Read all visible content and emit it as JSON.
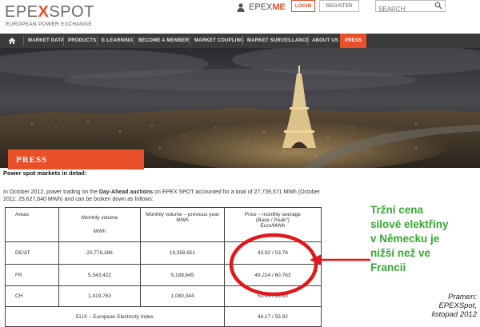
{
  "header": {
    "logo_text_a": "EPE",
    "logo_text_x": "X",
    "logo_text_b": "SPOT",
    "logo_subtitle": "EUROPEAN POWER EXCHANGE",
    "epexme_a": "EPEX",
    "epexme_b": "ME",
    "login_label": "LOGIN",
    "register_label": "REGISTER",
    "search_placeholder": "SEARCH"
  },
  "nav": {
    "items": [
      {
        "label": "MARKET DATA"
      },
      {
        "label": "PRODUCTS"
      },
      {
        "label": "E-LEARNING"
      },
      {
        "label": "BECOME A MEMBER"
      },
      {
        "label": "MARKET COUPLING"
      },
      {
        "label": "MARKET SURVEILLANCE"
      },
      {
        "label": "ABOUT US"
      },
      {
        "label": "PRESS"
      }
    ]
  },
  "hero": {
    "press_label": "PRESS"
  },
  "content": {
    "section_title": "Power spot markets in detail:",
    "intro_a": "In October 2012, power trading on the ",
    "intro_bold": "Day-Ahead auctions",
    "intro_b": " on EPEX SPOT accounted for a total of 27,739,571 MWh (October 2011: 25,627,640 MWh) and can be broken down as follows:"
  },
  "table": {
    "headers": {
      "areas": "Areas",
      "monthly_volume": "Monthly volume",
      "monthly_volume_unit": "MWh",
      "prev_volume": "Monthly volume – previous year",
      "prev_volume_unit": "MWh",
      "price": "Price – monthly average",
      "price_sub": "(Base / Peak*)",
      "price_unit": "Euro/MWh"
    },
    "rows": [
      {
        "area": "DE/AT",
        "volume": "20,776,386",
        "prev": "19,358,651",
        "price": "43.92 / 53.76"
      },
      {
        "area": "FR",
        "volume": "5,543,422",
        "prev": "5,188,645",
        "price": "49.224 / 60.763"
      },
      {
        "area": "CH",
        "volume": "1,419,763",
        "prev": "1,080,344",
        "price": "53.43 / 63.60"
      }
    ],
    "elix_label": "ELIX – European Electricity Index",
    "elix_price": "44.17 / 55.92"
  },
  "annotation": {
    "line1": "Tržní cena",
    "line2": "silové elektřiny",
    "line3": "v Německu je",
    "line4": "nižší než ve",
    "line5": "Francii",
    "color": "#36a832"
  },
  "source": {
    "line1": "Pramen:",
    "line2": "EPEXSpot,",
    "line3": "listopad 2012"
  },
  "colors": {
    "accent": "#e8502a",
    "nav_bg": "#3b3b3b",
    "highlight_red": "#e3161b"
  }
}
